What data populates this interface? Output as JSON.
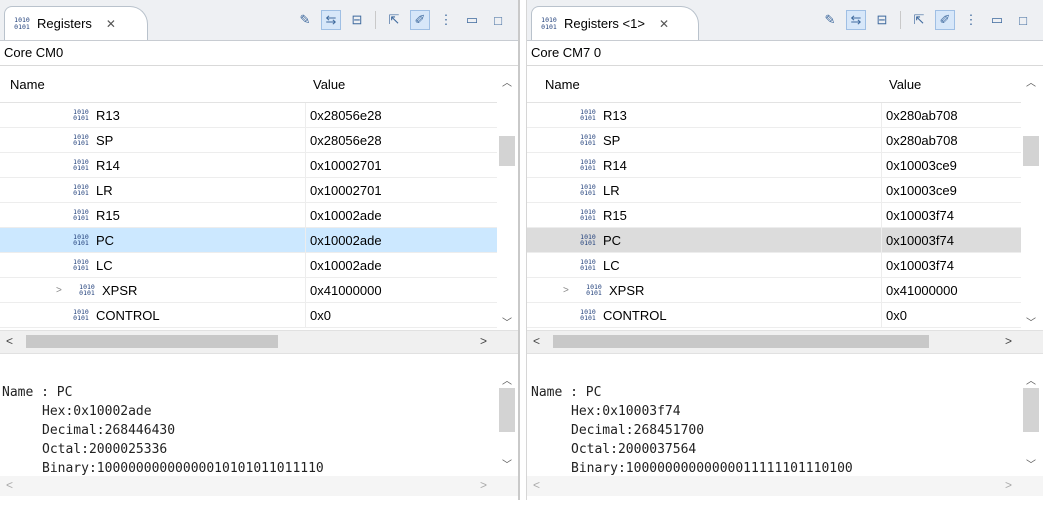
{
  "panels": [
    {
      "tab_title": "Registers",
      "core_label": "Core CM0",
      "columns": {
        "name": "Name",
        "value": "Value"
      },
      "rows": [
        {
          "name": "R13",
          "value": "0x28056e28"
        },
        {
          "name": "SP",
          "value": "0x28056e28"
        },
        {
          "name": "R14",
          "value": "0x10002701"
        },
        {
          "name": "LR",
          "value": "0x10002701"
        },
        {
          "name": "R15",
          "value": "0x10002ade"
        },
        {
          "name": "PC",
          "value": "0x10002ade"
        },
        {
          "name": "LC",
          "value": "0x10002ade"
        },
        {
          "name": "XPSR",
          "value": "0x41000000"
        },
        {
          "name": "CONTROL",
          "value": "0x0"
        }
      ],
      "details": {
        "name": "Name : PC",
        "hex": "Hex:0x10002ade",
        "decimal": "Decimal:268446430",
        "octal": "Octal:2000025336",
        "binary": "Binary:10000000000000010101011011110"
      }
    },
    {
      "tab_title": "Registers <1>",
      "core_label": "Core CM7 0",
      "columns": {
        "name": "Name",
        "value": "Value"
      },
      "rows": [
        {
          "name": "R13",
          "value": "0x280ab708"
        },
        {
          "name": "SP",
          "value": "0x280ab708"
        },
        {
          "name": "R14",
          "value": "0x10003ce9"
        },
        {
          "name": "LR",
          "value": "0x10003ce9"
        },
        {
          "name": "R15",
          "value": "0x10003f74"
        },
        {
          "name": "PC",
          "value": "0x10003f74"
        },
        {
          "name": "LC",
          "value": "0x10003f74"
        },
        {
          "name": "XPSR",
          "value": "0x41000000"
        },
        {
          "name": "CONTROL",
          "value": "0x0"
        }
      ],
      "details": {
        "name": "Name : PC",
        "hex": "Hex:0x10003f74",
        "decimal": "Decimal:268451700",
        "octal": "Octal:2000037564",
        "binary": "Binary:10000000000000011111101110100"
      }
    }
  ],
  "icons": {
    "register": "1010/0101 register glyph",
    "close": "close-x",
    "toolbar": [
      "add-register-group-icon",
      "sync-icon",
      "collapse-all-icon",
      "export-icon",
      "edit-icon",
      "view-menu-icon",
      "minimize-icon",
      "maximize-icon"
    ]
  },
  "colors": {
    "selection_active": "#cce8ff",
    "selection_inactive": "#dcdcdc",
    "register_icon": "#1f3e7a"
  },
  "selected_row": "PC",
  "expandable_row": "XPSR"
}
